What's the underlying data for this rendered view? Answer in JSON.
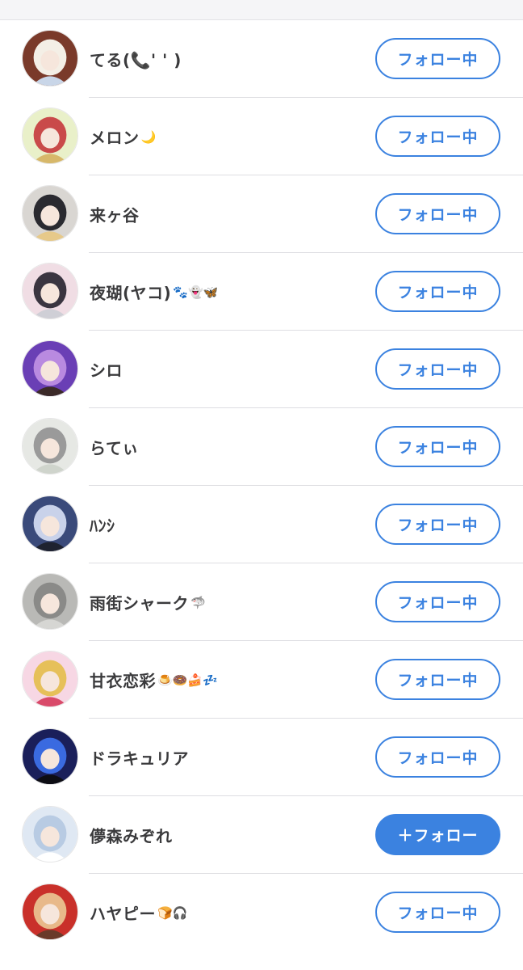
{
  "colors": {
    "accent": "#3b82e0",
    "name_text": "#3a3a3c",
    "divider": "#dedee2"
  },
  "users": [
    {
      "name": "てる(📞' ' )",
      "emoji": "",
      "button_label": "フォロー中",
      "following": true,
      "avatar_colors": [
        "#7a3a2a",
        "#f4efe6",
        "#c9d6e8"
      ]
    },
    {
      "name": "メロン",
      "emoji": "🌙",
      "button_label": "フォロー中",
      "following": true,
      "avatar_colors": [
        "#e9f0c9",
        "#c94a4a",
        "#d7b86a"
      ]
    },
    {
      "name": "来ヶ谷",
      "emoji": "",
      "button_label": "フォロー中",
      "following": true,
      "avatar_colors": [
        "#d9d6d2",
        "#2a2a30",
        "#e6c98a"
      ]
    },
    {
      "name": "夜瑚(ヤコ)",
      "emoji": "🐾👻🦋",
      "button_label": "フォロー中",
      "following": true,
      "avatar_colors": [
        "#f0dde4",
        "#3a3540",
        "#cfcfd6"
      ]
    },
    {
      "name": "シロ",
      "emoji": "",
      "button_label": "フォロー中",
      "following": true,
      "avatar_colors": [
        "#6a3fb5",
        "#b98ae0",
        "#3b2a28"
      ]
    },
    {
      "name": "らてぃ",
      "emoji": "",
      "button_label": "フォロー中",
      "following": true,
      "avatar_colors": [
        "#e6e8e4",
        "#9a9a9a",
        "#cfd4cc"
      ]
    },
    {
      "name": "ﾊﾝｼ",
      "emoji": "",
      "button_label": "フォロー中",
      "following": true,
      "avatar_colors": [
        "#3a4a7a",
        "#c9d2ea",
        "#1e2230"
      ]
    },
    {
      "name": "雨街シャーク",
      "emoji": "🦈",
      "button_label": "フォロー中",
      "following": true,
      "avatar_colors": [
        "#b9b9b6",
        "#8a8a88",
        "#d6d6d3"
      ]
    },
    {
      "name": "甘衣恋彩",
      "emoji": "🍮🍩🍰💤",
      "button_label": "フォロー中",
      "following": true,
      "avatar_colors": [
        "#f7d7e4",
        "#e6c05a",
        "#d94a6a"
      ]
    },
    {
      "name": "ドラキュリア",
      "emoji": "",
      "button_label": "フォロー中",
      "following": true,
      "avatar_colors": [
        "#1a1f5a",
        "#3a6ae0",
        "#0d0d14"
      ]
    },
    {
      "name": "儚森みぞれ",
      "emoji": "",
      "button_label": "＋フォロー",
      "following": false,
      "avatar_colors": [
        "#dfe8f3",
        "#b8cbe3",
        "#ffffff"
      ]
    },
    {
      "name": "ハヤピー",
      "emoji": "🍞🎧",
      "button_label": "フォロー中",
      "following": true,
      "avatar_colors": [
        "#c9302a",
        "#e8b98a",
        "#6a3a2a"
      ]
    }
  ]
}
